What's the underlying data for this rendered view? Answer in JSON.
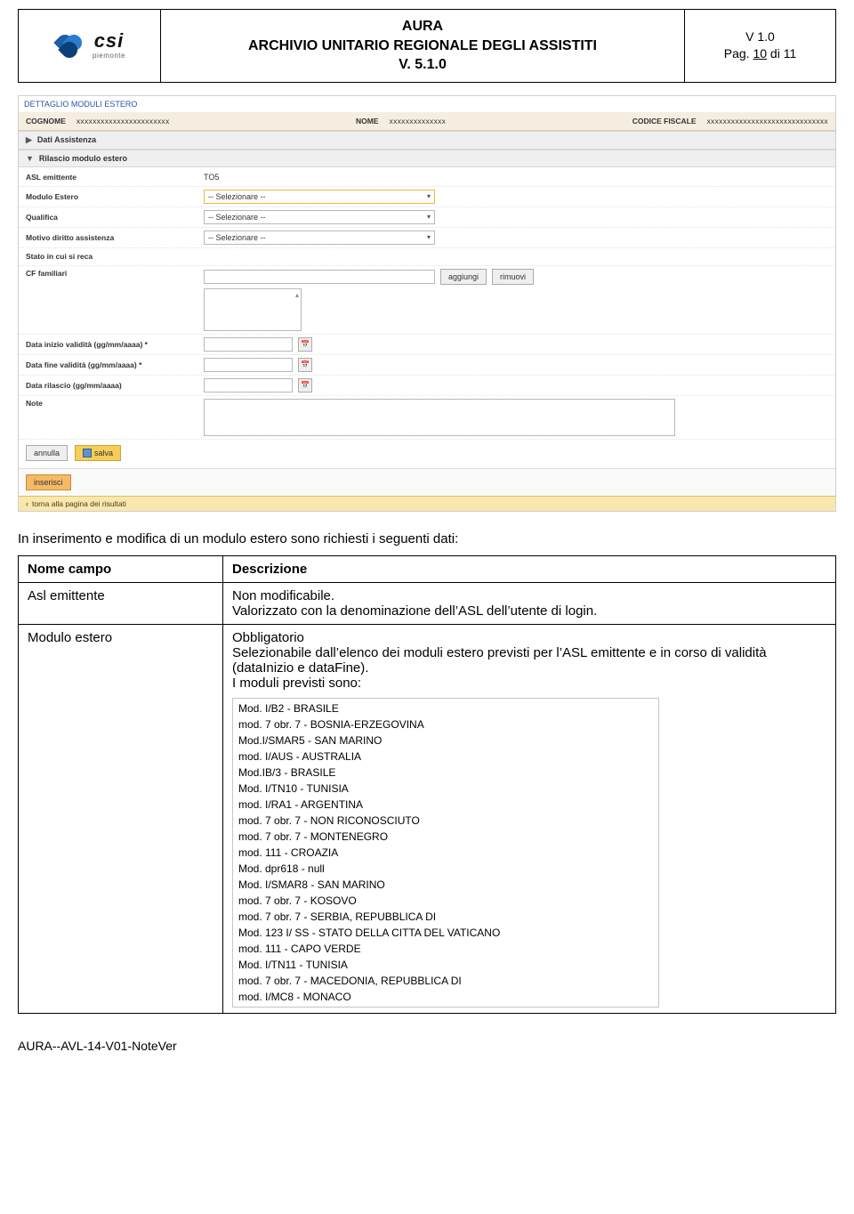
{
  "header": {
    "logo_name": "csi",
    "logo_sub": "piemonte",
    "title_line1": "AURA",
    "title_line2": "ARCHIVIO UNITARIO REGIONALE DEGLI ASSISTITI",
    "title_line3": "V. 5.1.0",
    "version": "V 1.0",
    "page_prefix": "Pag. ",
    "page_num": "10",
    "page_of": " di 11"
  },
  "app": {
    "section_title": "DETTAGLIO MODULI ESTERO",
    "summary": {
      "cognome_label": "COGNOME",
      "cognome_value": "xxxxxxxxxxxxxxxxxxxxxxx",
      "nome_label": "NOME",
      "nome_value": "xxxxxxxxxxxxxx",
      "cf_label": "CODICE FISCALE",
      "cf_value": "xxxxxxxxxxxxxxxxxxxxxxxxxxxxxx"
    },
    "accordion_dati_assistenza": "Dati Assistenza",
    "accordion_rilascio": "Rilascio modulo estero",
    "fields": {
      "asl_emittente_label": "ASL emittente",
      "asl_emittente_value": "TO5",
      "modulo_estero_label": "Modulo Estero",
      "qualifica_label": "Qualifica",
      "motivo_label": "Motivo diritto assistenza",
      "select_placeholder": "-- Selezionare --",
      "stato_label": "Stato in cui si reca",
      "cf_familiari_label": "CF familiari",
      "data_inizio_label": "Data inizio validità (gg/mm/aaaa) *",
      "data_fine_label": "Data fine validità (gg/mm/aaaa) *",
      "data_rilascio_label": "Data rilascio (gg/mm/aaaa)",
      "note_label": "Note"
    },
    "buttons": {
      "aggiungi": "aggiungi",
      "rimuovi": "rimuovi",
      "annulla": "annulla",
      "salva": "salva",
      "inserisci": "inserisci",
      "torna": "torna alla pagina dei risultati"
    }
  },
  "doc": {
    "intro": "In inserimento e modifica di un modulo estero sono richiesti i seguenti dati:",
    "table_header_name": "Nome campo",
    "table_header_desc": "Descrizione",
    "row1_name": "Asl emittente",
    "row1_desc_line1": "Non modificabile.",
    "row1_desc_line2": "Valorizzato con la denominazione dell’ASL dell’utente di login.",
    "row2_name": "Modulo estero",
    "row2_desc_line1": "Obbligatorio",
    "row2_desc_line2": "Selezionabile dall’elenco dei moduli estero previsti per l’ASL emittente e in corso di validità (dataInizio e dataFine).",
    "row2_desc_line3": "I moduli previsti sono:",
    "modules": [
      "Mod. I/B2 - BRASILE",
      "mod. 7 obr. 7 - BOSNIA-ERZEGOVINA",
      "Mod.I/SMAR5 - SAN MARINO",
      "mod. I/AUS - AUSTRALIA",
      "Mod.IB/3 - BRASILE",
      "Mod. I/TN10 - TUNISIA",
      "mod. I/RA1 - ARGENTINA",
      "mod. 7 obr. 7 - NON RICONOSCIUTO",
      "mod. 7 obr. 7 - MONTENEGRO",
      "mod. 111 - CROAZIA",
      "Mod. dpr618 - null",
      "Mod. I/SMAR8 - SAN MARINO",
      "mod. 7 obr. 7 - KOSOVO",
      "mod. 7 obr. 7 - SERBIA, REPUBBLICA DI",
      "Mod. 123 I/ SS - STATO DELLA CITTA DEL VATICANO",
      "mod. 111 - CAPO VERDE",
      "Mod. I/TN11 - TUNISIA",
      "mod. 7 obr. 7 - MACEDONIA, REPUBBLICA DI",
      "mod. I/MC8 - MONACO"
    ]
  },
  "footer_id": "AURA--AVL-14-V01-NoteVer"
}
